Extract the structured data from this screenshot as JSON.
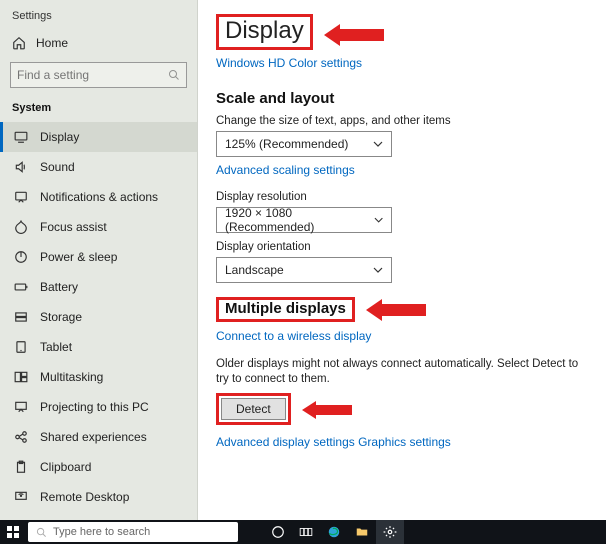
{
  "window_title": "Settings",
  "sidebar": {
    "home": "Home",
    "search_placeholder": "Find a setting",
    "section": "System",
    "items": [
      "Display",
      "Sound",
      "Notifications & actions",
      "Focus assist",
      "Power & sleep",
      "Battery",
      "Storage",
      "Tablet",
      "Multitasking",
      "Projecting to this PC",
      "Shared experiences",
      "Clipboard",
      "Remote Desktop"
    ]
  },
  "main": {
    "title": "Display",
    "hd_link": "Windows HD Color settings",
    "scale_heading": "Scale and layout",
    "scale_label": "Change the size of text, apps, and other items",
    "scale_value": "125% (Recommended)",
    "advanced_scaling": "Advanced scaling settings",
    "resolution_label": "Display resolution",
    "resolution_value": "1920 × 1080 (Recommended)",
    "orientation_label": "Display orientation",
    "orientation_value": "Landscape",
    "multiple_heading": "Multiple displays",
    "wireless_link": "Connect to a wireless display",
    "detect_helper": "Older displays might not always connect automatically. Select Detect to try to connect to them.",
    "detect_button": "Detect",
    "advanced_display": "Advanced display settings",
    "graphics_link": "Graphics settings"
  },
  "taskbar": {
    "search_placeholder": "Type here to search"
  }
}
